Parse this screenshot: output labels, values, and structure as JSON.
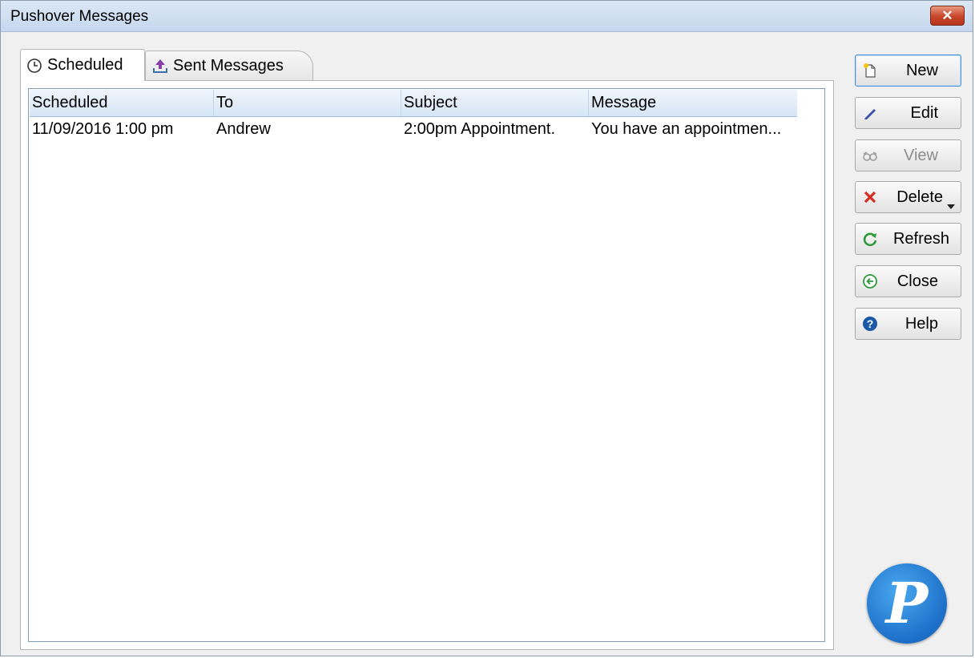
{
  "window": {
    "title": "Pushover Messages",
    "close_glyph": "✕"
  },
  "tabs": [
    {
      "label": "Scheduled",
      "icon": "clock-icon",
      "active": true
    },
    {
      "label": "Sent Messages",
      "icon": "upload-icon",
      "active": false
    }
  ],
  "list": {
    "columns": [
      "Scheduled",
      "To",
      "Subject",
      "Message"
    ],
    "rows": [
      {
        "scheduled": "11/09/2016 1:00 pm",
        "to": "Andrew",
        "subject": "2:00pm Appointment.",
        "message": "You have an appointmen..."
      }
    ]
  },
  "buttons": [
    {
      "label": "New",
      "icon": "new-document-icon",
      "enabled": true,
      "default": true
    },
    {
      "label": "Edit",
      "icon": "pencil-icon",
      "enabled": true
    },
    {
      "label": "View",
      "icon": "glasses-icon",
      "enabled": false
    },
    {
      "label": "Delete",
      "icon": "red-x-icon",
      "enabled": true,
      "has_dropdown": true
    },
    {
      "label": "Refresh",
      "icon": "refresh-icon",
      "enabled": true
    },
    {
      "label": "Close",
      "icon": "back-arrow-circle-icon",
      "enabled": true
    },
    {
      "label": "Help",
      "icon": "question-circle-icon",
      "enabled": true
    }
  ],
  "logo": {
    "letter": "P",
    "color": "#1c6fc8"
  },
  "colors": {
    "accent": "#4a90d9",
    "delete_red": "#d62d20",
    "refresh_green": "#2e9a3a",
    "help_blue": "#1a5aa8"
  }
}
